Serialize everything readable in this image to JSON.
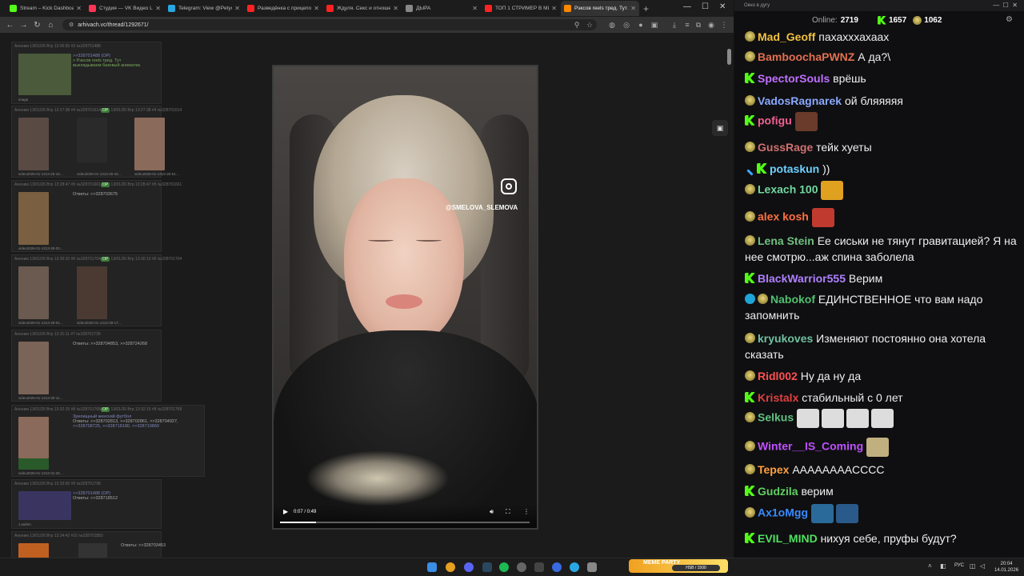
{
  "browser": {
    "tabs": [
      {
        "label": "Stream – Kick Dashboa…",
        "color": "#53fc18"
      },
      {
        "label": "Студия — VK Видео Li…",
        "color": "#ff3355"
      },
      {
        "label": "Telegram: View @Petyc…",
        "color": "#2aa7e3"
      },
      {
        "label": "Разведёнка с прицепо…",
        "color": "#ff2222"
      },
      {
        "label": "Ждуля. Секс и отношен…",
        "color": "#ff2222"
      },
      {
        "label": "ДЫРА",
        "color": "#888888"
      },
      {
        "label": "ТОП 1 СТРИМЕР В МИ…",
        "color": "#ff2222"
      },
      {
        "label": "Рэксов reels тред. Тут…",
        "color": "#ff8800",
        "active": true
      }
    ],
    "url": "arhivach.vc/thread/1292671/",
    "posts": [
      {
        "hdr": "Аноним 13/01/26 Втр 13:06:55 #3 №328701488",
        "lines": [
          ">>328701488 (OP)",
          "> Рэксов reels тред. Тут",
          "выкладываем базовый аниматик."
        ],
        "caps": [
          "image"
        ]
      },
      {
        "hdr": "Аноним 13/01/26 Втр 13:27:38 #4 №328701614",
        "op": "OP",
        "caps": [
          "video2026-01-1313-26-16…",
          "video2026-01-1313-26-42…",
          "video2026-01-1313-26-51…"
        ]
      },
      {
        "hdr": "Аноним 13/01/26 Втр 13:28:47 #5 №328701661",
        "op": "OP",
        "lines": [
          "Ответы: >>328703675"
        ],
        "caps": [
          "video2026-01-1313-28-03…"
        ]
      },
      {
        "hdr": "Аноним 13/01/26 Втр 13:30:10 #6 №328701704",
        "op": "OP",
        "caps": [
          "video2026-01-1313-29-01…",
          "video2026-01-1313-29-17…"
        ]
      },
      {
        "hdr": "Аноним 13/01/26 Втр 13:31:11 #7 №328701739",
        "lines": [
          "Ответы: >>328704853, >>328724268"
        ],
        "caps": [
          "video2026-01-1313-30-11…"
        ]
      },
      {
        "hdr": "Аноним 13/01/26 Втр 13:32:15 #8 №328701768",
        "op": "OP",
        "lines": [
          "Зрелищный женский футбол",
          "Ответы: >>328702813, >>328702861, >>328704927,",
          ">>328708725, >>328718180, >>328719860"
        ],
        "caps": [
          "video2026-01-1313-31-25…"
        ]
      },
      {
        "hdr": "Аноним 13/01/26 Втр 13:33:00 #9 №328701798",
        "lines": [
          ">>328701488 (OP)",
          "Ответы: >>328718512"
        ],
        "caps": [
          "1.webm"
        ]
      },
      {
        "hdr": "Аноним 13/01/26 Втр 13:34:42 #10 №328701850",
        "lines": [
          "Ответы: >>328703453"
        ],
        "caps": []
      }
    ]
  },
  "video": {
    "handle": "@SMELOVA_SLEMOVA",
    "time": "0:07 / 0:49",
    "progress": 0.143
  },
  "chat": {
    "window_title": "Окно в дугу",
    "online_label": "Online:",
    "online": "2719",
    "stat1": "1657",
    "stat2": "1062",
    "messages": [
      {
        "badges": [
          "sub"
        ],
        "user": "Mad_Geoff",
        "color": "#f0c040",
        "text": "пахахххахаах"
      },
      {
        "badges": [
          "sub"
        ],
        "user": "BamboochaPWNZ",
        "color": "#e07050",
        "text": "А да?\\"
      },
      {
        "badges": [
          "k"
        ],
        "user": "SpectorSouls",
        "color": "#c070ff",
        "text": "врёшь"
      },
      {
        "badges": [
          "sub"
        ],
        "user": "VadosRagnarek",
        "color": "#8aa8ff",
        "text": "ой бляяяяя"
      },
      {
        "badges": [
          "k"
        ],
        "user": "pofigu",
        "color": "#f06090",
        "text": "",
        "emotes": [
          "#6a3a2a"
        ]
      },
      {
        "badges": [
          "sub"
        ],
        "user": "GussRage",
        "color": "#d07070",
        "text": "тейк хуеты"
      },
      {
        "badges": [
          "mod",
          "k"
        ],
        "user": "potaskun",
        "color": "#6fd0ff",
        "text": "))"
      },
      {
        "badges": [
          "sub"
        ],
        "user": "Lexach 100",
        "color": "#70d8a0",
        "text": "",
        "emotes": [
          "#e0a020"
        ]
      },
      {
        "badges": [
          "sub"
        ],
        "user": "alex kosh",
        "color": "#ff7040",
        "text": "",
        "emotes": [
          "#c03a30"
        ]
      },
      {
        "badges": [
          "sub"
        ],
        "user": "Lena Stein",
        "color": "#70c080",
        "text": "Ее сиськи не тянут гравитацией? Я на нее смотрю...аж спина заболела"
      },
      {
        "badges": [
          "k"
        ],
        "user": "BlackWarrior555",
        "color": "#b080ff",
        "text": "Верим"
      },
      {
        "badges": [
          "ver",
          "sub"
        ],
        "user": "Nabokof",
        "color": "#50c070",
        "text": "ЕДИНСТВЕННОЕ что вам надо запомнить"
      },
      {
        "badges": [
          "sub"
        ],
        "user": "kryukoves",
        "color": "#70c0a0",
        "text": "Изменяют постоянно она хотела сказать"
      },
      {
        "badges": [
          "sub"
        ],
        "user": "Ridl002",
        "color": "#ff5050",
        "text": "Ну да ну да"
      },
      {
        "badges": [
          "k"
        ],
        "user": "Kristalx",
        "color": "#e04040",
        "text": "стабильный с 0 лет"
      },
      {
        "badges": [
          "sub"
        ],
        "user": "Selkus",
        "color": "#60c080",
        "text": "",
        "emotes": [
          "#ddd",
          "#ddd",
          "#ddd",
          "#ddd"
        ]
      },
      {
        "badges": [
          "sub"
        ],
        "user": "Winter__IS_Coming",
        "color": "#c050ff",
        "text": "",
        "emotes": [
          "#c0b080"
        ]
      },
      {
        "badges": [
          "sub"
        ],
        "user": "Tepex",
        "color": "#ffa040",
        "text": "АААААААACCCC"
      },
      {
        "badges": [
          "k"
        ],
        "user": "Gudzila",
        "color": "#60d060",
        "text": "верим"
      },
      {
        "badges": [
          "sub"
        ],
        "user": "Ax1oMgg",
        "color": "#3a8aff",
        "text": "",
        "emotes": [
          "#2a6a9a",
          "#2a5a8a"
        ]
      },
      {
        "badges": [
          "k"
        ],
        "user": "EVIL_MIND",
        "color": "#50e060",
        "text": "нихуя себе, пруфы будут?"
      }
    ]
  },
  "taskbar": {
    "lang": "РУС",
    "time": "20:04",
    "date": "14.01.2026",
    "meme_label": "MEME PARTY",
    "meme_progress": "HSB / 1500"
  }
}
